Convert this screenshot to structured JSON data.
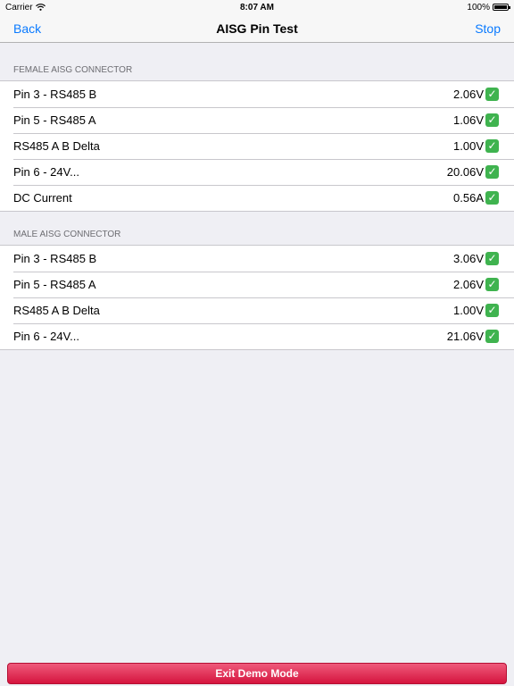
{
  "status_bar": {
    "carrier": "Carrier",
    "time": "8:07 AM",
    "battery": "100%",
    "battery_level": 1.0
  },
  "nav": {
    "back_label": "Back",
    "title": "AISG Pin Test",
    "stop_label": "Stop"
  },
  "female": {
    "header": "FEMALE AISG CONNECTOR",
    "rows": [
      {
        "label": "Pin 3 - RS485 B",
        "value": "2.06V"
      },
      {
        "label": "Pin 5 - RS485 A",
        "value": "1.06V"
      },
      {
        "label": "RS485 A B Delta",
        "value": "1.00V"
      },
      {
        "label": "Pin 6 - 24V...",
        "value": "20.06V"
      },
      {
        "label": "DC Current",
        "value": "0.56A"
      }
    ]
  },
  "male": {
    "header": "MALE AISG CONNECTOR",
    "rows": [
      {
        "label": "Pin 3 - RS485 B",
        "value": "3.06V"
      },
      {
        "label": "Pin 5 - RS485 A",
        "value": "2.06V"
      },
      {
        "label": "RS485 A B Delta",
        "value": "1.00V"
      },
      {
        "label": "Pin 6 - 24V...",
        "value": "21.06V"
      }
    ]
  },
  "status_icon": "check-mark-icon",
  "colors": {
    "accent": "#0a7aff",
    "check": "#3fb34f",
    "exit": "#d5143e"
  },
  "exit_label": "Exit Demo Mode"
}
